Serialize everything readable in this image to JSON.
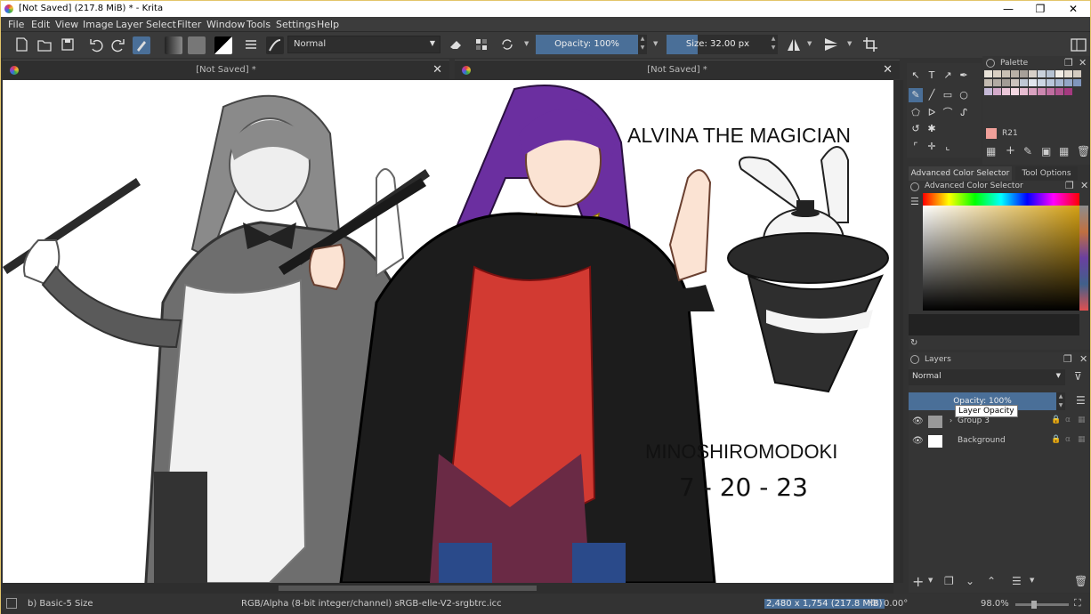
{
  "window": {
    "title": "[Not Saved]  (217.8 MiB)  * - Krita",
    "minimize": "—",
    "maximize": "❐",
    "close": "✕"
  },
  "menu": [
    "File",
    "Edit",
    "View",
    "Image",
    "Layer",
    "Select",
    "Filter",
    "Window",
    "Tools",
    "Settings",
    "Help"
  ],
  "toolbar": {
    "blend_mode": "Normal",
    "opacity": "Opacity: 100%",
    "opacity_value": 1.0,
    "size": "Size: 32.00 px",
    "size_fill": 0.3
  },
  "tabs": [
    {
      "title": "[Not Saved]  *",
      "close": "✕"
    },
    {
      "title": "[Not Saved]  *",
      "close": "✕"
    }
  ],
  "artwork": {
    "title": "ALVINA THE MAGICIAN",
    "artist": "MINOSHIROMODOKI",
    "date": "7 - 20 - 23"
  },
  "palette": {
    "title": "Palette",
    "current_color_name": "R21",
    "current_color": "#f0a09a"
  },
  "dock_tabs": [
    "Advanced Color Selector",
    "Tool Options"
  ],
  "advanced_color_selector": {
    "title": "Advanced Color Selector"
  },
  "layers": {
    "title": "Layers",
    "blend_mode": "Normal",
    "opacity": "Opacity:  100%",
    "tooltip": "Layer Opacity",
    "items": [
      {
        "name": "Group 3"
      },
      {
        "name": "Background"
      }
    ]
  },
  "status": {
    "brush": "b) Basic-5 Size",
    "color_space": "RGB/Alpha (8-bit integer/channel)  sRGB-elle-V2-srgbtrc.icc",
    "dimensions": "2,480 x 1,754 (217.8 MiB)",
    "rotation": "0.00°",
    "zoom": "98.0%"
  },
  "colors": {
    "accent": "#4a6f98",
    "panel": "#353535",
    "titlebar_border": "#e3c56a"
  }
}
